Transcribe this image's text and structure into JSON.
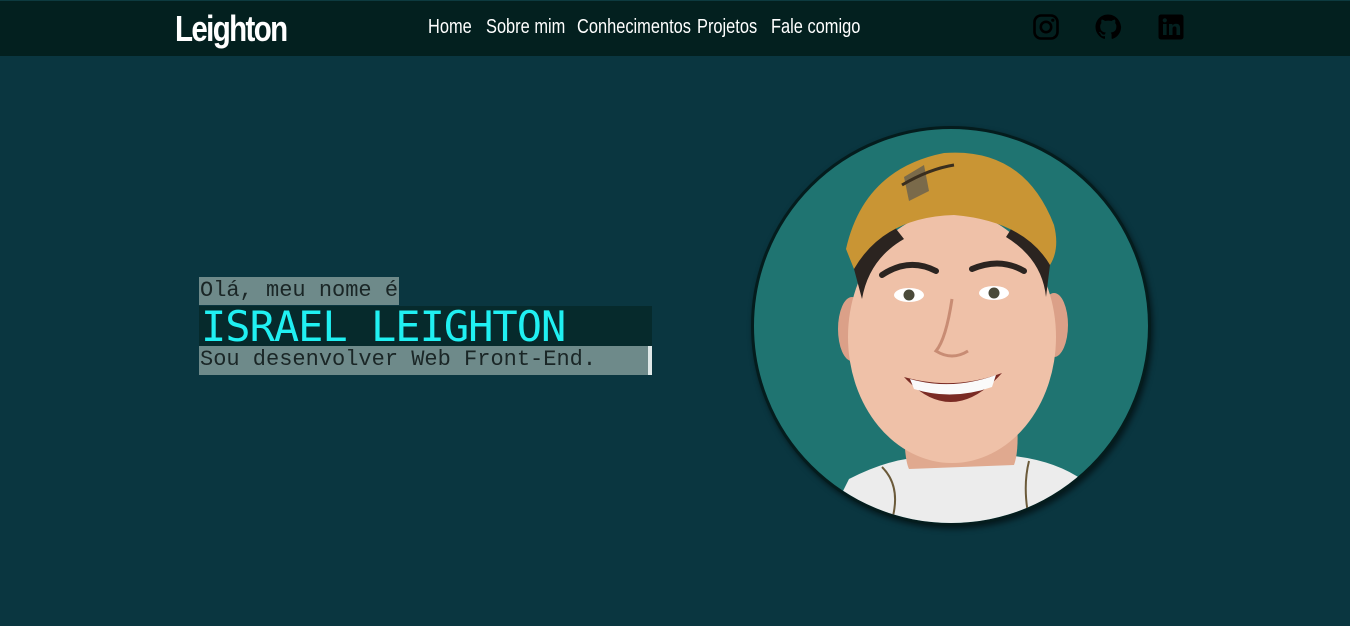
{
  "header": {
    "logo": "Leighton",
    "nav": [
      {
        "label": "Home"
      },
      {
        "label": "Sobre mim"
      },
      {
        "label": "Conhecimentos"
      },
      {
        "label": "Projetos"
      },
      {
        "label": "Fale comigo"
      }
    ],
    "social": [
      {
        "icon": "instagram-icon"
      },
      {
        "icon": "github-icon"
      },
      {
        "icon": "linkedin-icon"
      }
    ]
  },
  "hero": {
    "greeting": "Olá, meu nome é",
    "name": "ISRAEL LEIGHTON",
    "role": "Sou desenvolver Web Front-End."
  },
  "colors": {
    "background": "#0a3640",
    "topbar": "#03201f",
    "name_accent": "#20f0f2",
    "highlight": "#6e8a8a",
    "photo_bg": "#1f7471"
  }
}
